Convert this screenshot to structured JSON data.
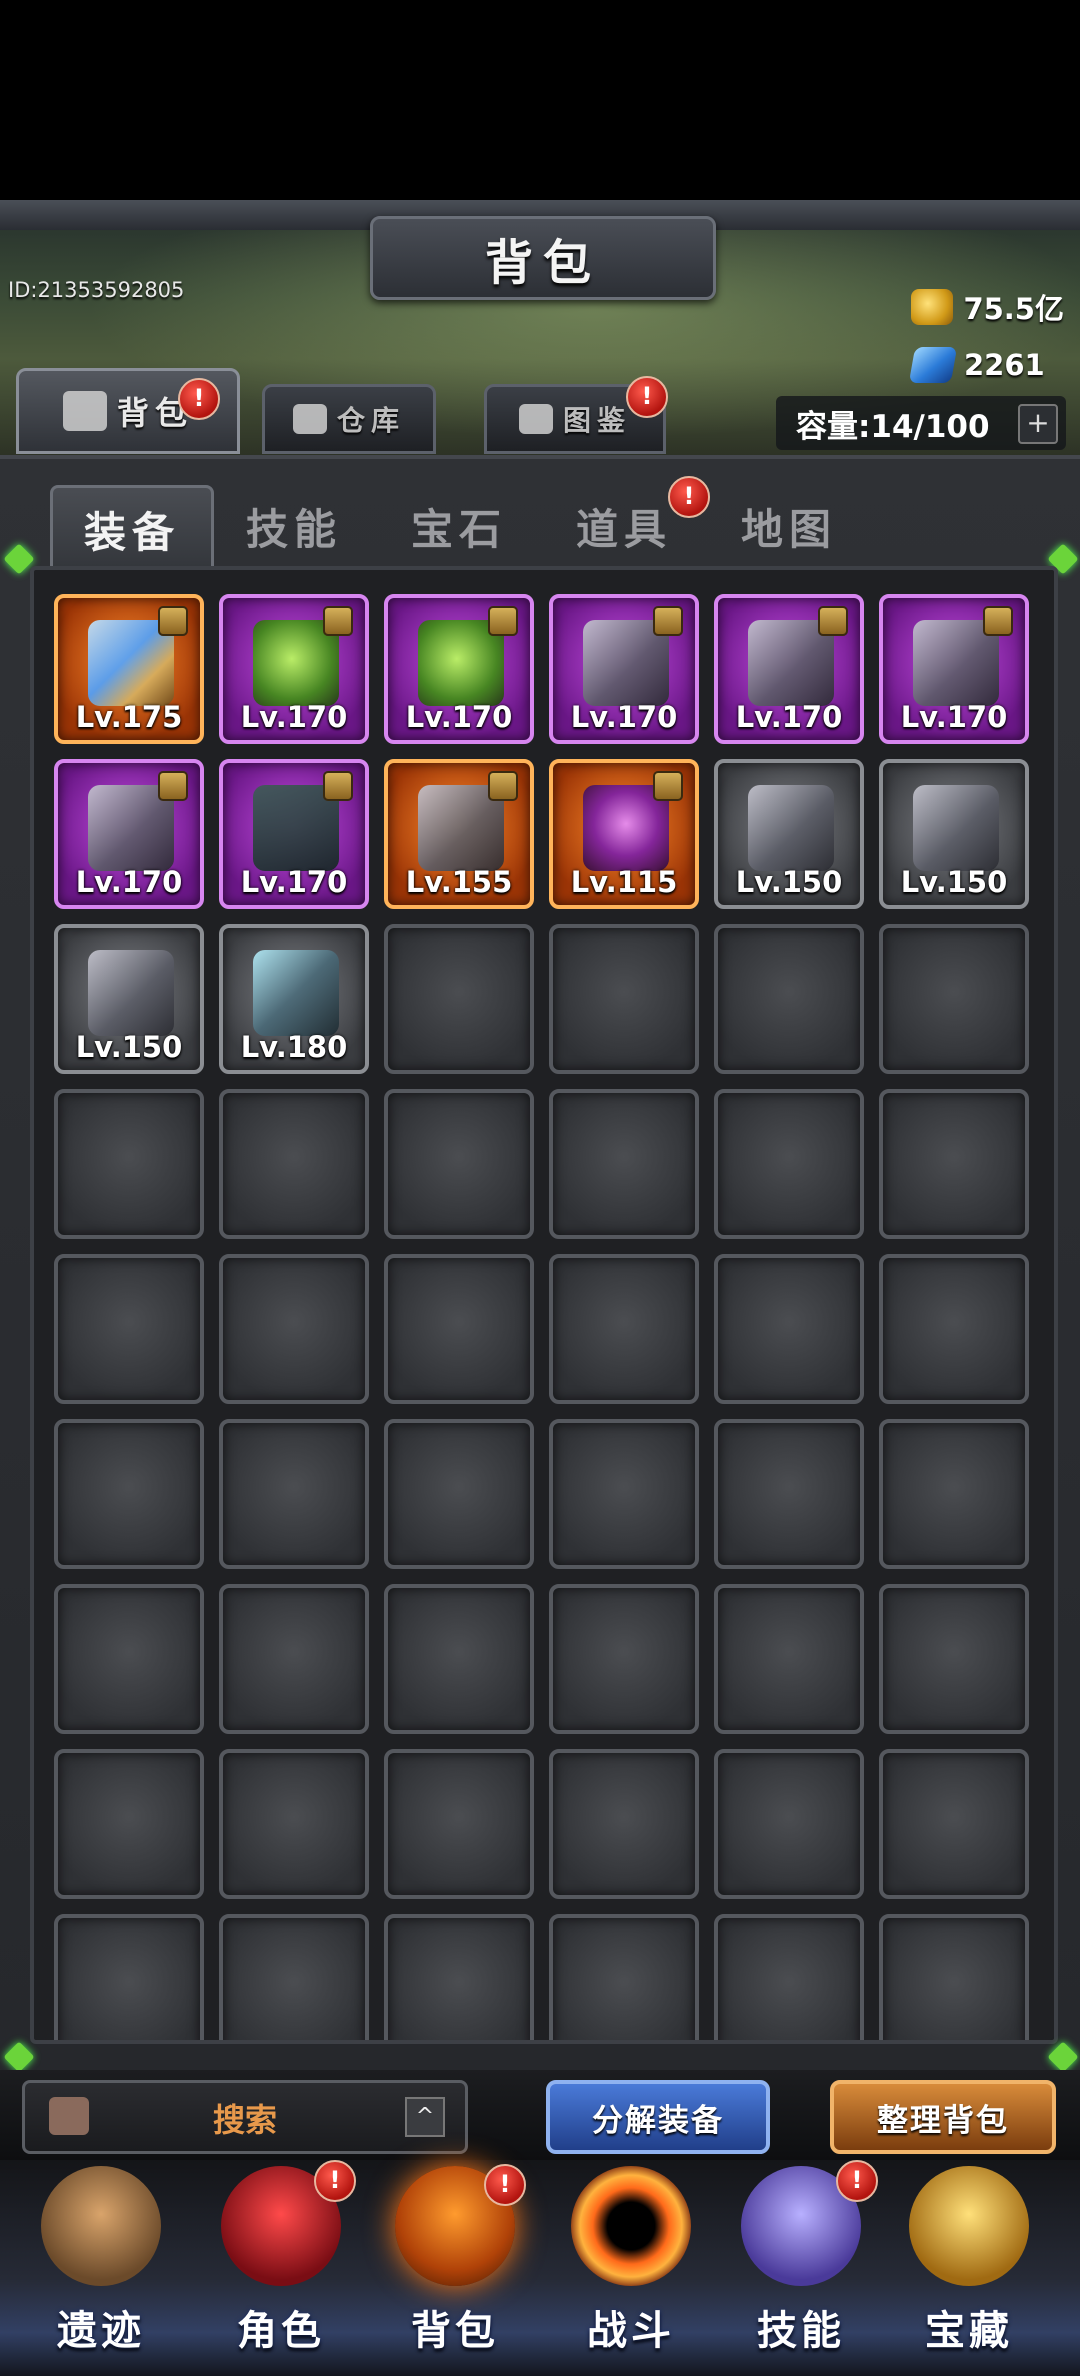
{
  "header": {
    "title": "背包",
    "player_id": "ID:21353592805",
    "gold": "75.5亿",
    "gems": "2261",
    "capacity": "容量:14/100",
    "capacity_add": "+"
  },
  "main_tabs": [
    {
      "label": "背包",
      "badge": "!"
    },
    {
      "label": "仓库"
    },
    {
      "label": "图鉴",
      "badge": "!"
    }
  ],
  "sub_tabs": [
    {
      "label": "装备"
    },
    {
      "label": "技能"
    },
    {
      "label": "宝石"
    },
    {
      "label": "道具",
      "badge": "!"
    },
    {
      "label": "地图"
    }
  ],
  "items": [
    {
      "level": "Lv.175",
      "rarity": "orange",
      "icon": "sword-icon"
    },
    {
      "level": "Lv.170",
      "rarity": "purple",
      "icon": "amulet-icon"
    },
    {
      "level": "Lv.170",
      "rarity": "purple",
      "icon": "ring-icon"
    },
    {
      "level": "Lv.170",
      "rarity": "purple",
      "icon": "leg-armor-icon"
    },
    {
      "level": "Lv.170",
      "rarity": "purple",
      "icon": "shoulder-armor-icon"
    },
    {
      "level": "Lv.170",
      "rarity": "purple",
      "icon": "gauntlet-icon"
    },
    {
      "level": "Lv.170",
      "rarity": "purple",
      "icon": "chest-armor-icon"
    },
    {
      "level": "Lv.170",
      "rarity": "purple",
      "icon": "wizard-hat-icon"
    },
    {
      "level": "Lv.155",
      "rarity": "orange",
      "icon": "bracer-icon"
    },
    {
      "level": "Lv.115",
      "rarity": "orange",
      "icon": "orb-ring-icon"
    },
    {
      "level": "Lv.150",
      "rarity": "gray",
      "icon": "leg-armor-icon"
    },
    {
      "level": "Lv.150",
      "rarity": "gray",
      "icon": "belt-icon"
    },
    {
      "level": "Lv.150",
      "rarity": "gray",
      "icon": "leg-armor-icon"
    },
    {
      "level": "Lv.180",
      "rarity": "gray",
      "icon": "bow-icon"
    }
  ],
  "bottom": {
    "search_label": "搜索",
    "search_arrow": "^",
    "decompose_label": "分解装备",
    "sort_label": "整理背包"
  },
  "nav": [
    {
      "label": "遗迹"
    },
    {
      "label": "角色",
      "badge": "!"
    },
    {
      "label": "背包",
      "badge": "!"
    },
    {
      "label": "战斗"
    },
    {
      "label": "技能",
      "badge": "!"
    },
    {
      "label": "宝藏"
    }
  ]
}
